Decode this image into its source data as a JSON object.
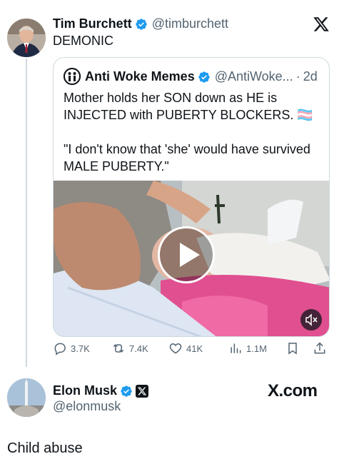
{
  "post": {
    "author_name": "Tim Burchett",
    "author_handle": "@timburchett",
    "text": "DEMONIC"
  },
  "quote": {
    "author_name": "Anti Woke Memes",
    "author_handle": "@AntiWoke...",
    "separator": "·",
    "time": "2d",
    "line1": "Mother holds her SON down as HE is",
    "line2": "INJECTED with PUBERTY BLOCKERS. 🏳️‍⚧️",
    "line3": "\"I don't know that 'she' would have survived",
    "line4": "MALE PUBERTY.\""
  },
  "actions": {
    "replies": "3.7K",
    "reposts": "7.4K",
    "likes": "41K",
    "views": "1.1M"
  },
  "reply": {
    "author_name": "Elon Musk",
    "author_handle": "@elonmusk",
    "brand": "X.com",
    "text": "Child abuse"
  },
  "colors": {
    "verified_blue": "#1d9bf0",
    "text_primary": "#0f1419",
    "text_secondary": "#536471",
    "border": "#cfd9de"
  }
}
